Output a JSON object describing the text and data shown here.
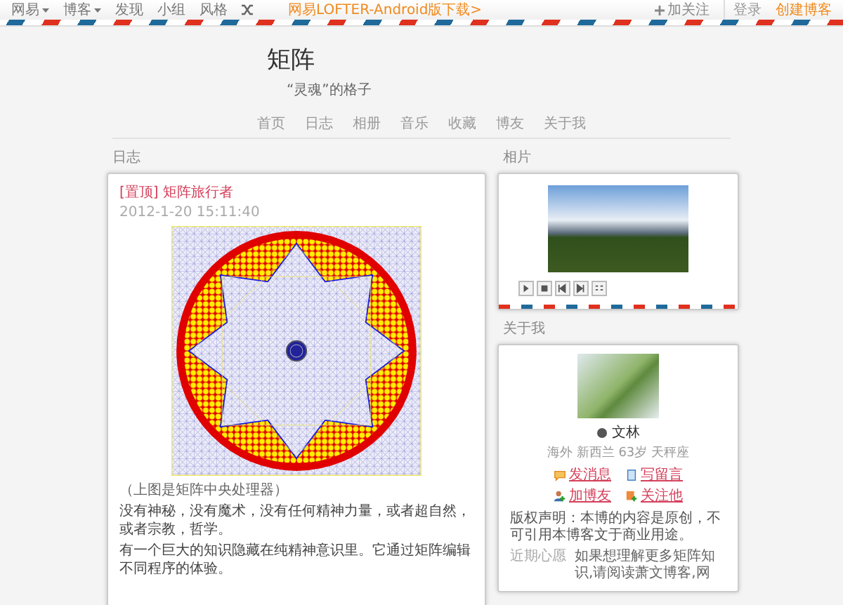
{
  "top_bar": {
    "menus": [
      {
        "label": "网易",
        "dropdown": true
      },
      {
        "label": "博客",
        "dropdown": true
      },
      {
        "label": "发现",
        "dropdown": false
      },
      {
        "label": "小组",
        "dropdown": false
      },
      {
        "label": "风格",
        "dropdown": false
      }
    ],
    "promo": "网易LOFTER-Android版下载>",
    "follow": "加关注",
    "login": "登录",
    "create_blog": "创建博客"
  },
  "blog": {
    "title": "矩阵",
    "subtitle": "“灵魂”的格子"
  },
  "nav": [
    "首页",
    "日志",
    "相册",
    "音乐",
    "收藏",
    "博友",
    "关于我"
  ],
  "journal": {
    "heading": "日志",
    "post": {
      "title": "[置顶] 矩阵旅行者",
      "date": "2012-1-20 15:11:40",
      "caption": "（上图是矩阵中央处理器）",
      "paragraphs": [
        "没有神秘，没有魔术，没有任何精神力量，或者超自然，或者宗教，哲学。",
        "有一个巨大的知识隐藏在纯精神意识里。它通过矩阵编辑不同程序的体验。"
      ]
    }
  },
  "photos": {
    "heading": "相片"
  },
  "about": {
    "heading": "关于我",
    "name": "文林",
    "details": "海外 新西兰 63岁 天秤座",
    "actions": [
      {
        "label": "发消息",
        "kind": "message"
      },
      {
        "label": "写留言",
        "kind": "note"
      },
      {
        "label": "加博友",
        "kind": "add-friend"
      },
      {
        "label": "关注他",
        "kind": "follow"
      }
    ],
    "copyright": "版权声明：本博的内容是原创，不可引用本博客文于商业用途。",
    "wish_label": "近期心愿",
    "wish": "如果想理解更多矩阵知识,请阅读萧文博客,网"
  }
}
